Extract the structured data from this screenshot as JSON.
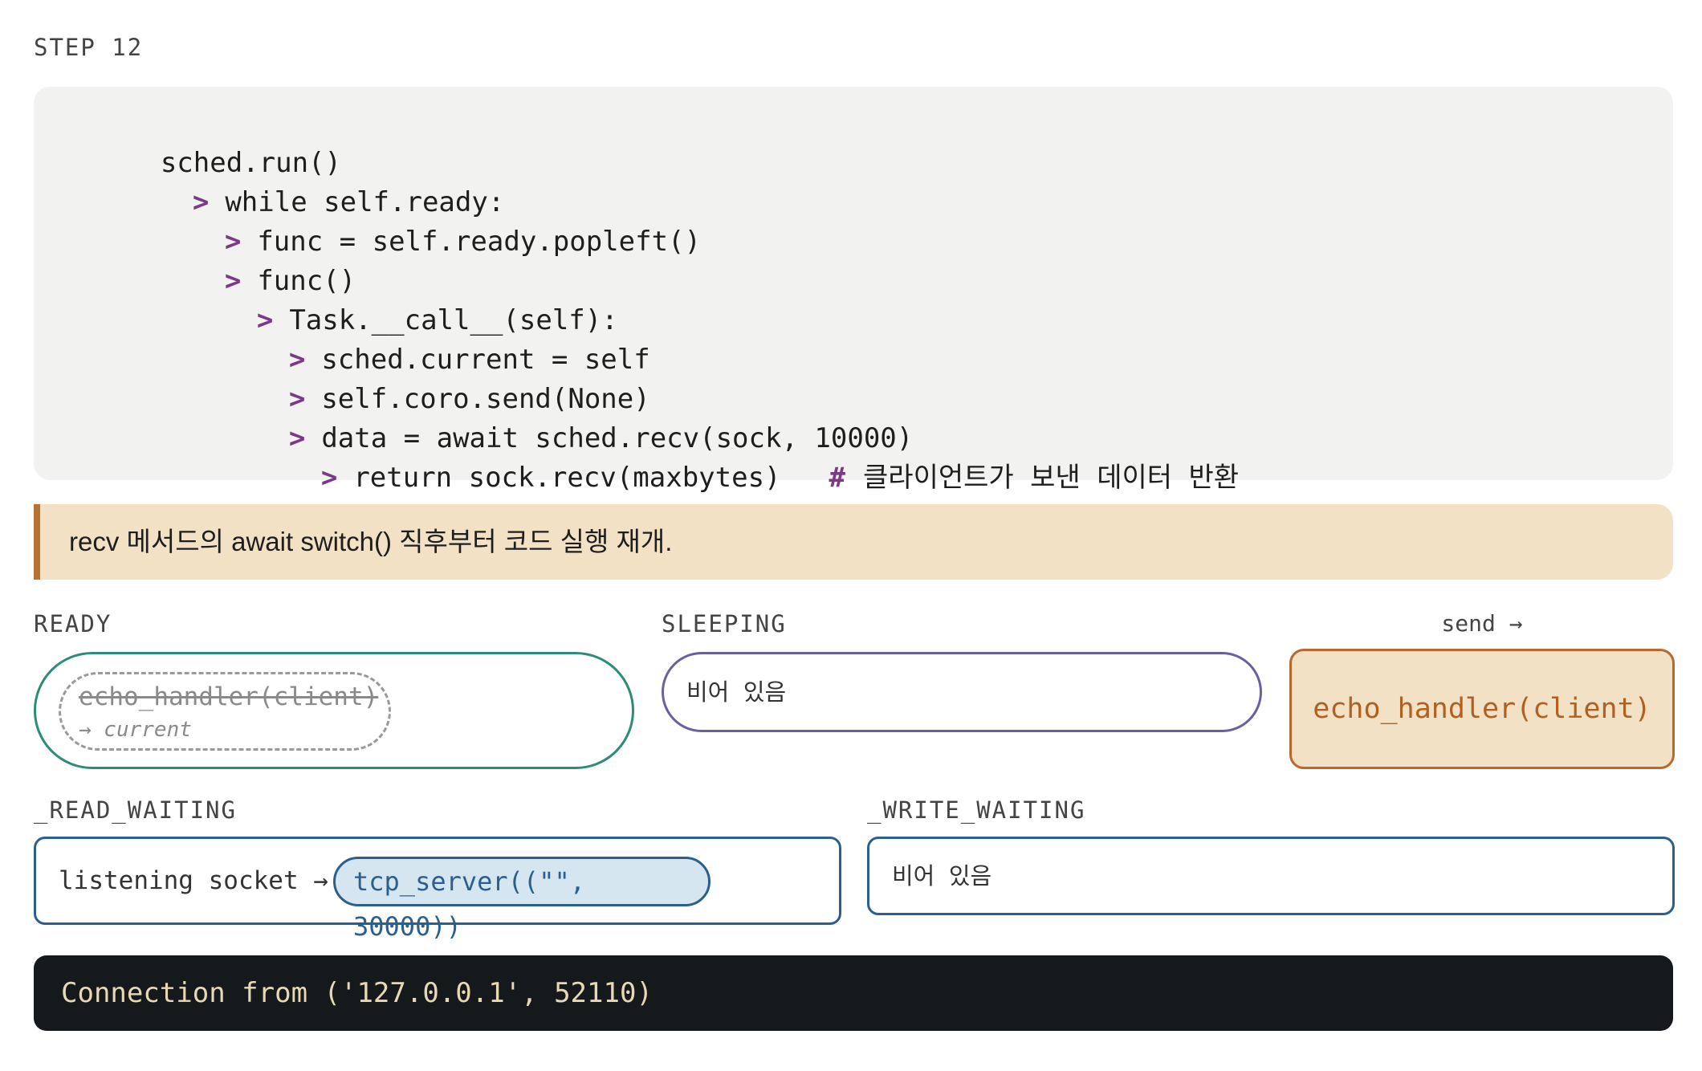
{
  "step_label": "STEP 12",
  "code": {
    "lines": [
      {
        "arrow": "",
        "text": "sched.run()",
        "comment": ""
      },
      {
        "arrow": ">",
        "text": "while self.ready:",
        "comment": ""
      },
      {
        "arrow": ">",
        "text": "func = self.ready.popleft()",
        "comment": ""
      },
      {
        "arrow": ">",
        "text": "func()",
        "comment": ""
      },
      {
        "arrow": ">",
        "text": "Task.__call__(self):",
        "comment": ""
      },
      {
        "arrow": ">",
        "text": "sched.current = self",
        "comment": ""
      },
      {
        "arrow": ">",
        "text": "self.coro.send(None)",
        "comment": ""
      },
      {
        "arrow": ">",
        "text": "data = await sched.recv(sock, 10000)",
        "comment": ""
      },
      {
        "arrow": ">",
        "text": "return sock.recv(maxbytes)",
        "comment_hash": "#",
        "comment": "클라이언트가 보낸 데이터 반환"
      }
    ]
  },
  "note": "recv 메서드의 await switch() 직후부터 코드 실행 재개.",
  "ready": {
    "label": "READY",
    "chip_name": "echo_handler(client)",
    "chip_note": "→ current"
  },
  "sleeping": {
    "label": "SLEEPING",
    "empty_text": "비어 있음"
  },
  "send": {
    "label": "send →",
    "task": "echo_handler(client)"
  },
  "read_waiting": {
    "label": "_READ_WAITING",
    "prefix": "listening socket →",
    "chip": "tcp_server((\"\", 30000))"
  },
  "write_waiting": {
    "label": "_WRITE_WAITING",
    "empty_text": "비어 있음"
  },
  "console": {
    "output": "Connection from ('127.0.0.1', 52110)"
  },
  "colors": {
    "accent_arrow": "#7b3a86",
    "ready_border": "#2e8b77",
    "sleeping_border": "#6b5fa0",
    "send_fill": "#f3e1c5",
    "send_text": "#b0601f",
    "waiting_border": "#2a5f8f",
    "console_bg": "#15191c",
    "console_text": "#e8d9b4"
  }
}
